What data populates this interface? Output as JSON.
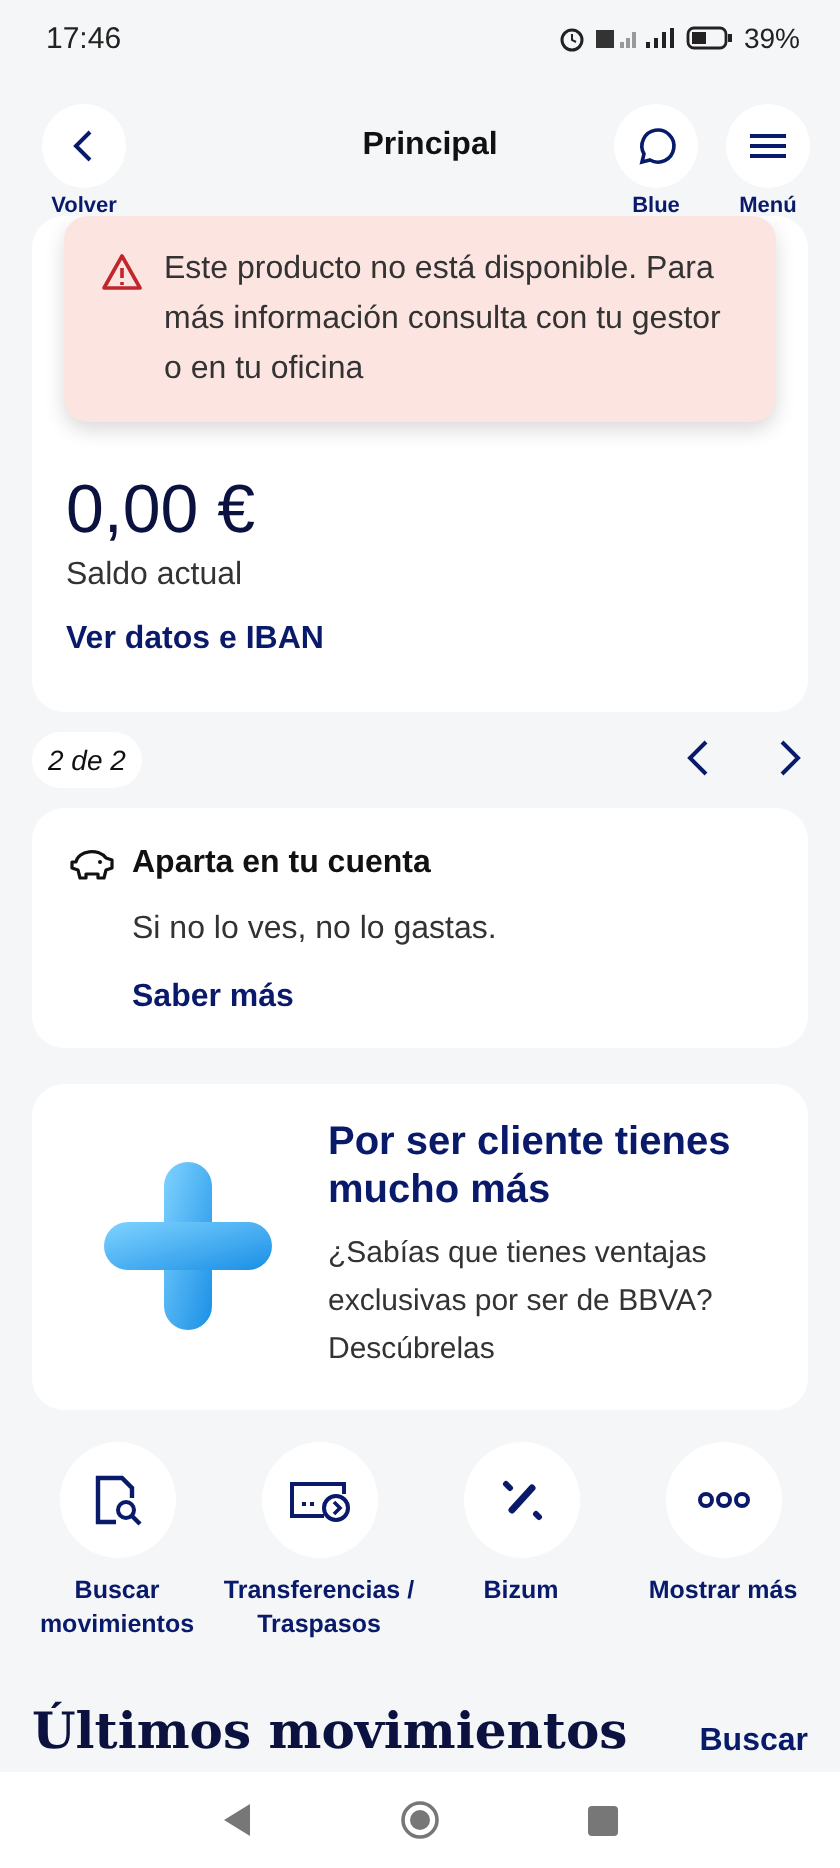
{
  "status_bar": {
    "time": "17:46",
    "battery": "39%"
  },
  "header": {
    "back": "Volver",
    "title": "Principal",
    "chat": "Blue",
    "menu": "Menú"
  },
  "toast": {
    "message": "Este producto no está disponible. Para más información consulta con tu gestor o en tu oficina"
  },
  "account": {
    "balance": "0,00 €",
    "balance_label": "Saldo actual",
    "link": "Ver datos e IBAN"
  },
  "pager": {
    "label": "2 de 2"
  },
  "savings_card": {
    "title": "Aparta en tu cuenta",
    "text": "Si no lo ves, no lo gastas.",
    "link": "Saber más"
  },
  "promo": {
    "title": "Por ser cliente tienes mucho más",
    "text": "¿Sabías que tienes ventajas exclusivas por ser de BBVA? Descúbrelas"
  },
  "actions": [
    {
      "kind": "search",
      "label": "Buscar movimientos"
    },
    {
      "kind": "transfer",
      "label": "Transferencias / Traspasos"
    },
    {
      "kind": "bizum",
      "label": "Bizum"
    },
    {
      "kind": "more",
      "label": "Mostrar más"
    }
  ],
  "movements": {
    "title": "Últimos movimientos",
    "link": "Buscar"
  }
}
